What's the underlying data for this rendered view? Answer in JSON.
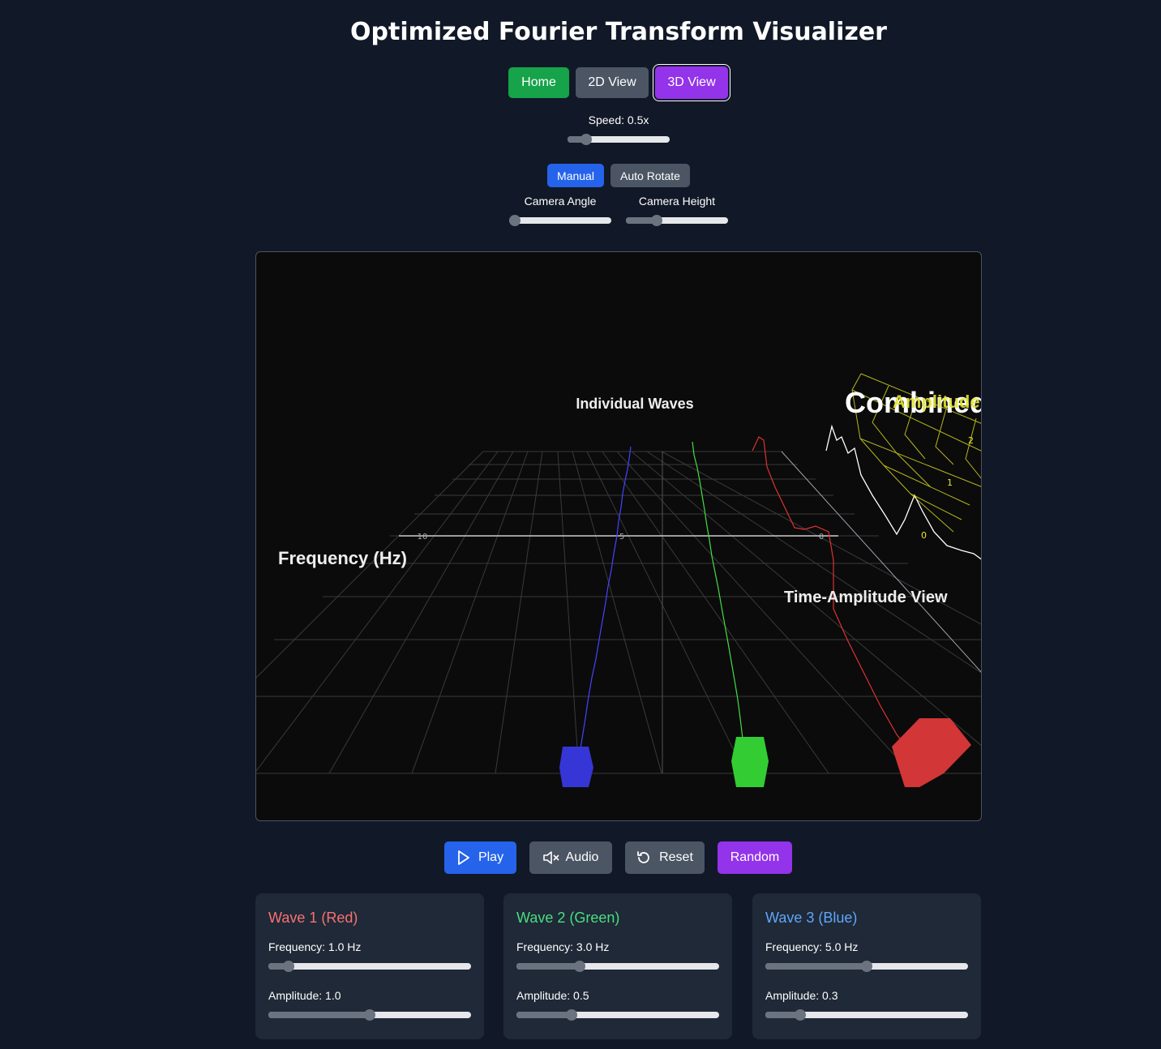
{
  "header": {
    "title": "Optimized Fourier Transform Visualizer"
  },
  "nav": {
    "home": "Home",
    "view2d": "2D View",
    "view3d": "3D View",
    "active": "3D View"
  },
  "speed": {
    "label": "Speed: 0.5x",
    "value": 0.5,
    "fraction": 0.18
  },
  "camera": {
    "manual": "Manual",
    "auto_rotate": "Auto Rotate",
    "mode": "Manual",
    "angle_label": "Camera Angle",
    "angle_fraction": 0.0,
    "height_label": "Camera Height",
    "height_fraction": 0.3
  },
  "scene": {
    "labels": {
      "individual": "Individual Waves",
      "combined": "Combined",
      "amplitude": "Amplitude",
      "frequency": "Frequency (Hz)",
      "time_amp": "Time-Amplitude View"
    },
    "ticks": [
      "10",
      "5",
      "0"
    ],
    "amp_ticks": [
      "2",
      "1",
      "0"
    ]
  },
  "controls": {
    "play": "Play",
    "audio": "Audio",
    "reset": "Reset",
    "random": "Random"
  },
  "waves": [
    {
      "title": "Wave 1 (Red)",
      "color": "#f87171",
      "freq_label": "Frequency: 1.0 Hz",
      "freq_fraction": 0.1,
      "amp_label": "Amplitude: 1.0",
      "amp_fraction": 0.5
    },
    {
      "title": "Wave 2 (Green)",
      "color": "#4ade80",
      "freq_label": "Frequency: 3.0 Hz",
      "freq_fraction": 0.31,
      "amp_label": "Amplitude: 0.5",
      "amp_fraction": 0.27
    },
    {
      "title": "Wave 3 (Blue)",
      "color": "#60a5fa",
      "freq_label": "Frequency: 5.0 Hz",
      "freq_fraction": 0.5,
      "amp_label": "Amplitude: 0.3",
      "amp_fraction": 0.17
    }
  ],
  "colors": {
    "background": "#111827",
    "panel": "#1f2937",
    "green": "#16a34a",
    "purple": "#9333ea",
    "blue": "#2563eb",
    "gray": "#4b5563"
  }
}
